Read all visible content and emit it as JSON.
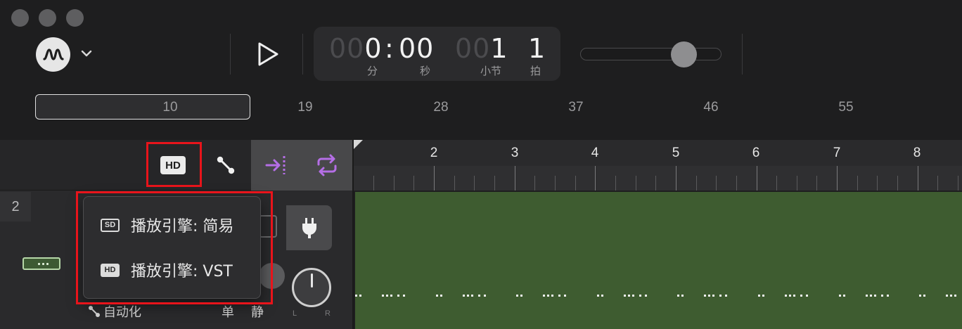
{
  "window": {
    "controls": [
      "close",
      "minimize",
      "zoom"
    ]
  },
  "transport": {
    "logo_icon": "waveform-logo-icon",
    "play_icon": "play-icon",
    "time": {
      "minutes_dim": "00",
      "minutes": "0",
      "separator": ":",
      "seconds": "00",
      "bar_dim": "00",
      "bar": "1",
      "beat": "1",
      "label_minutes": "分",
      "label_seconds": "秒",
      "label_bar": "小节",
      "label_beat": "拍"
    },
    "volume_level": 0.72
  },
  "overview": {
    "labels": [
      "10",
      "19",
      "28",
      "37",
      "46",
      "55"
    ]
  },
  "toolbar": {
    "hd_label": "HD",
    "automation_icon": "automation-icon",
    "snap_icon": "snap-to-icon",
    "loop_icon": "loop-icon"
  },
  "timeline": {
    "bars": [
      "2",
      "3",
      "4",
      "5",
      "6",
      "7",
      "8"
    ]
  },
  "track": {
    "number": "2",
    "automation_label": "自动化",
    "solo_label": "单",
    "mute_label": "静",
    "pan_left": "L",
    "pan_right": "R",
    "plugin_icon": "plug-icon",
    "region_color": "#3e5c30"
  },
  "menu": {
    "items": [
      {
        "tag": "SD",
        "label": "播放引擎: 简易"
      },
      {
        "tag": "HD",
        "label": "播放引擎: VST"
      }
    ]
  },
  "highlight_color": "#e8141b"
}
